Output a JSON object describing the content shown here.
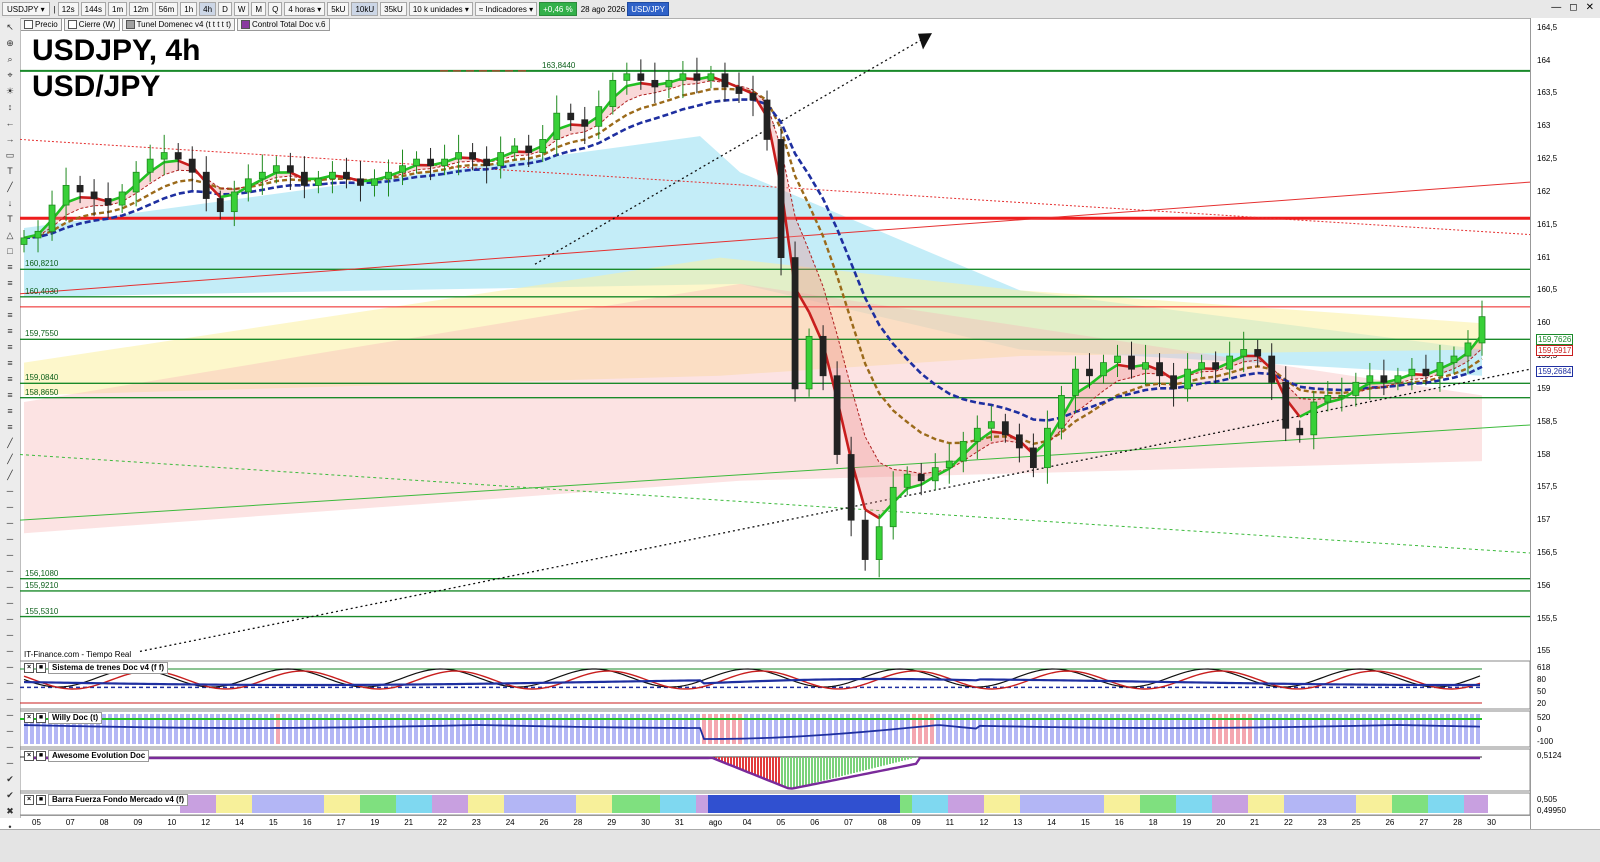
{
  "toolbar": {
    "symbol": "USDJPY",
    "intervals": [
      "12s",
      "144s",
      "1m",
      "12m",
      "56m",
      "1h",
      "4h",
      "D",
      "W",
      "M",
      "Q"
    ],
    "active_interval": "4h",
    "period_label": "4 horas",
    "unit_buttons": [
      "5kU",
      "10kU",
      "35kU"
    ],
    "units_label": "10 k unidades",
    "indicators_label": "Indicadores",
    "change": "+0,46 %",
    "date": "28 ago 2026",
    "pair": "USD/JPY"
  },
  "legend_chips": [
    {
      "label": "Precio",
      "color": "#ffffff"
    },
    {
      "label": "Cierre (W)",
      "color": "#ffffff"
    },
    {
      "label": "Tunel Domenec v4 (t t t t t)",
      "color": "#a0a0a0"
    },
    {
      "label": "Control Total Doc v.6",
      "color": "#8a3aa0"
    }
  ],
  "title": {
    "line1": "USDJPY, 4h",
    "line2": "USD/JPY"
  },
  "source": "IT-Finance.com - Tiempo Real",
  "price_axis": [
    "164,5",
    "164",
    "163,5",
    "163",
    "162,5",
    "162",
    "161,5",
    "161",
    "160,5",
    "160",
    "159,5",
    "159",
    "158,5",
    "158",
    "157,5",
    "157",
    "156,5",
    "156",
    "155,5",
    "155"
  ],
  "price_tags": [
    {
      "text": "159,7626",
      "color": "#1a8a2a"
    },
    {
      "text": "159,5917",
      "color": "#c81e1e"
    },
    {
      "text": "159,2684",
      "color": "#1e2fa0"
    }
  ],
  "level_labels": [
    "163,8440",
    "160,8210",
    "160,4030",
    "159,7550",
    "159,0840",
    "158,8650",
    "156,1080",
    "155,9210",
    "155,5310"
  ],
  "x_labels": [
    "05",
    "07",
    "08",
    "09",
    "10",
    "12",
    "14",
    "15",
    "16",
    "17",
    "19",
    "21",
    "22",
    "23",
    "24",
    "26",
    "28",
    "29",
    "30",
    "31",
    "ago",
    "04",
    "05",
    "06",
    "07",
    "08",
    "09",
    "11",
    "12",
    "13",
    "14",
    "15",
    "16",
    "18",
    "19",
    "20",
    "21",
    "22",
    "23",
    "25",
    "26",
    "27",
    "28",
    "30"
  ],
  "panels": [
    {
      "title": "Sistema de trenes Doc v4 (f f)",
      "scale": [
        "618",
        "80",
        "50",
        "20"
      ]
    },
    {
      "title": "Willy Doc (t)",
      "scale": [
        "520",
        "0",
        "-100"
      ]
    },
    {
      "title": "Awesome Evolution Doc",
      "scale": [
        "0,5124"
      ]
    },
    {
      "title": "Barra Fuerza Fondo Mercado v4 (f)",
      "scale": [
        "0,505",
        "0,49950"
      ]
    }
  ],
  "chart_data": {
    "type": "candlestick",
    "title": "USDJPY, 4h",
    "subtitle": "USD/JPY",
    "ylim": [
      154.9,
      164.65
    ],
    "yticks": [
      164.5,
      164,
      163.5,
      163,
      162.5,
      162,
      161.5,
      161,
      160.5,
      160,
      159.5,
      159,
      158.5,
      158,
      157.5,
      157,
      156.5,
      156,
      155.5,
      155
    ],
    "horizontal_levels": [
      163.844,
      160.821,
      160.403,
      159.755,
      159.084,
      158.865,
      156.108,
      155.921,
      155.531
    ],
    "resistance_red": 161.6,
    "close_series": [
      161.3,
      161.4,
      161.8,
      162.1,
      162.0,
      161.9,
      161.8,
      162.0,
      162.3,
      162.5,
      162.6,
      162.5,
      162.3,
      161.9,
      161.7,
      162.0,
      162.2,
      162.3,
      162.4,
      162.3,
      162.1,
      162.2,
      162.3,
      162.2,
      162.1,
      162.2,
      162.3,
      162.4,
      162.5,
      162.4,
      162.5,
      162.6,
      162.5,
      162.4,
      162.6,
      162.7,
      162.6,
      162.8,
      163.2,
      163.1,
      163.0,
      163.3,
      163.7,
      163.8,
      163.7,
      163.6,
      163.7,
      163.8,
      163.7,
      163.8,
      163.6,
      163.5,
      163.4,
      162.8,
      161.0,
      159.0,
      159.8,
      159.2,
      158.0,
      157.0,
      156.4,
      156.9,
      157.5,
      157.7,
      157.6,
      157.8,
      157.9,
      158.2,
      158.4,
      158.5,
      158.3,
      158.1,
      157.8,
      158.4,
      158.9,
      159.3,
      159.2,
      159.4,
      159.5,
      159.3,
      159.4,
      159.2,
      159.0,
      159.3,
      159.4,
      159.3,
      159.5,
      159.6,
      159.5,
      159.1,
      158.4,
      158.3,
      158.8,
      158.9,
      158.9,
      159.1,
      159.2,
      159.1,
      159.2,
      159.3,
      159.2,
      159.4,
      159.5,
      159.7,
      160.1
    ]
  }
}
